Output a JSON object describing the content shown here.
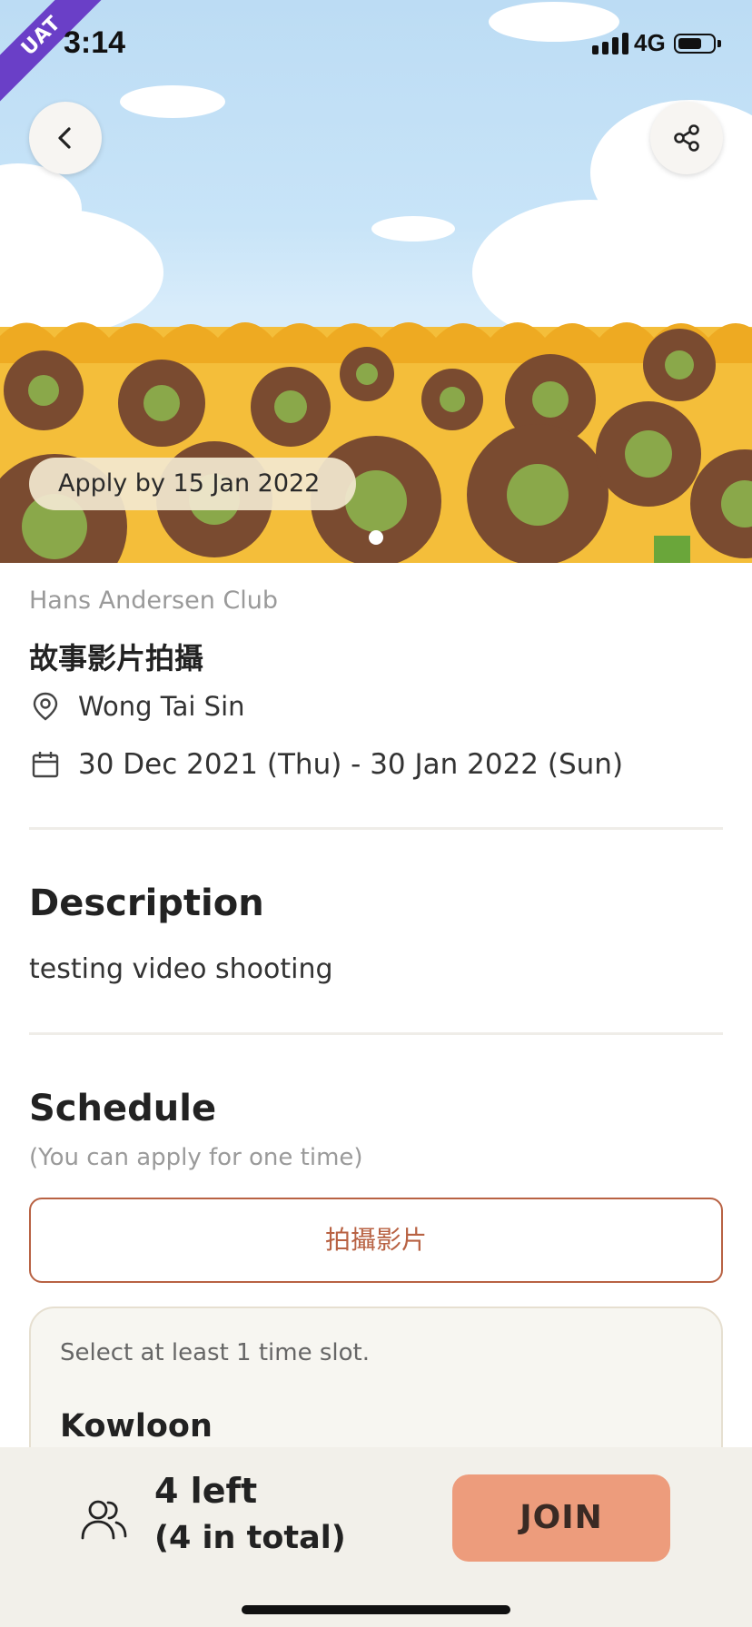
{
  "status_bar": {
    "time": "3:14",
    "network": "4G",
    "battery_level": 0.7,
    "badge": "UAT"
  },
  "hero": {
    "apply_by": "Apply by 15 Jan 2022",
    "carousel_page": 1,
    "carousel_total": 1,
    "icons": {
      "back": "chevron-left-icon",
      "share": "share-icon"
    }
  },
  "event": {
    "organizer": "Hans Andersen Club",
    "title": "故事影片拍攝",
    "location": "Wong Tai Sin",
    "date_range": "30 Dec 2021 (Thu) - 30 Jan 2022 (Sun)",
    "icons": {
      "location": "location-pin-icon",
      "date": "calendar-icon"
    }
  },
  "description": {
    "heading": "Description",
    "text": "testing video shooting"
  },
  "schedule": {
    "heading": "Schedule",
    "subtitle": "(You can apply for one time)",
    "session_label": "拍攝影片",
    "slot_hint": "Select at least 1 time slot.",
    "region": "Kowloon"
  },
  "footer": {
    "quota_left": "4 left",
    "quota_total": "(4 in total)",
    "join_label": "JOIN",
    "icons": {
      "people": "people-icon"
    }
  },
  "colors": {
    "accent": "#b86243",
    "join_button": "#ed9c7c",
    "card_bg": "#f7f6f1",
    "footer_bg": "#f2f0ea",
    "uat_ribbon": "#6a3fc7"
  }
}
